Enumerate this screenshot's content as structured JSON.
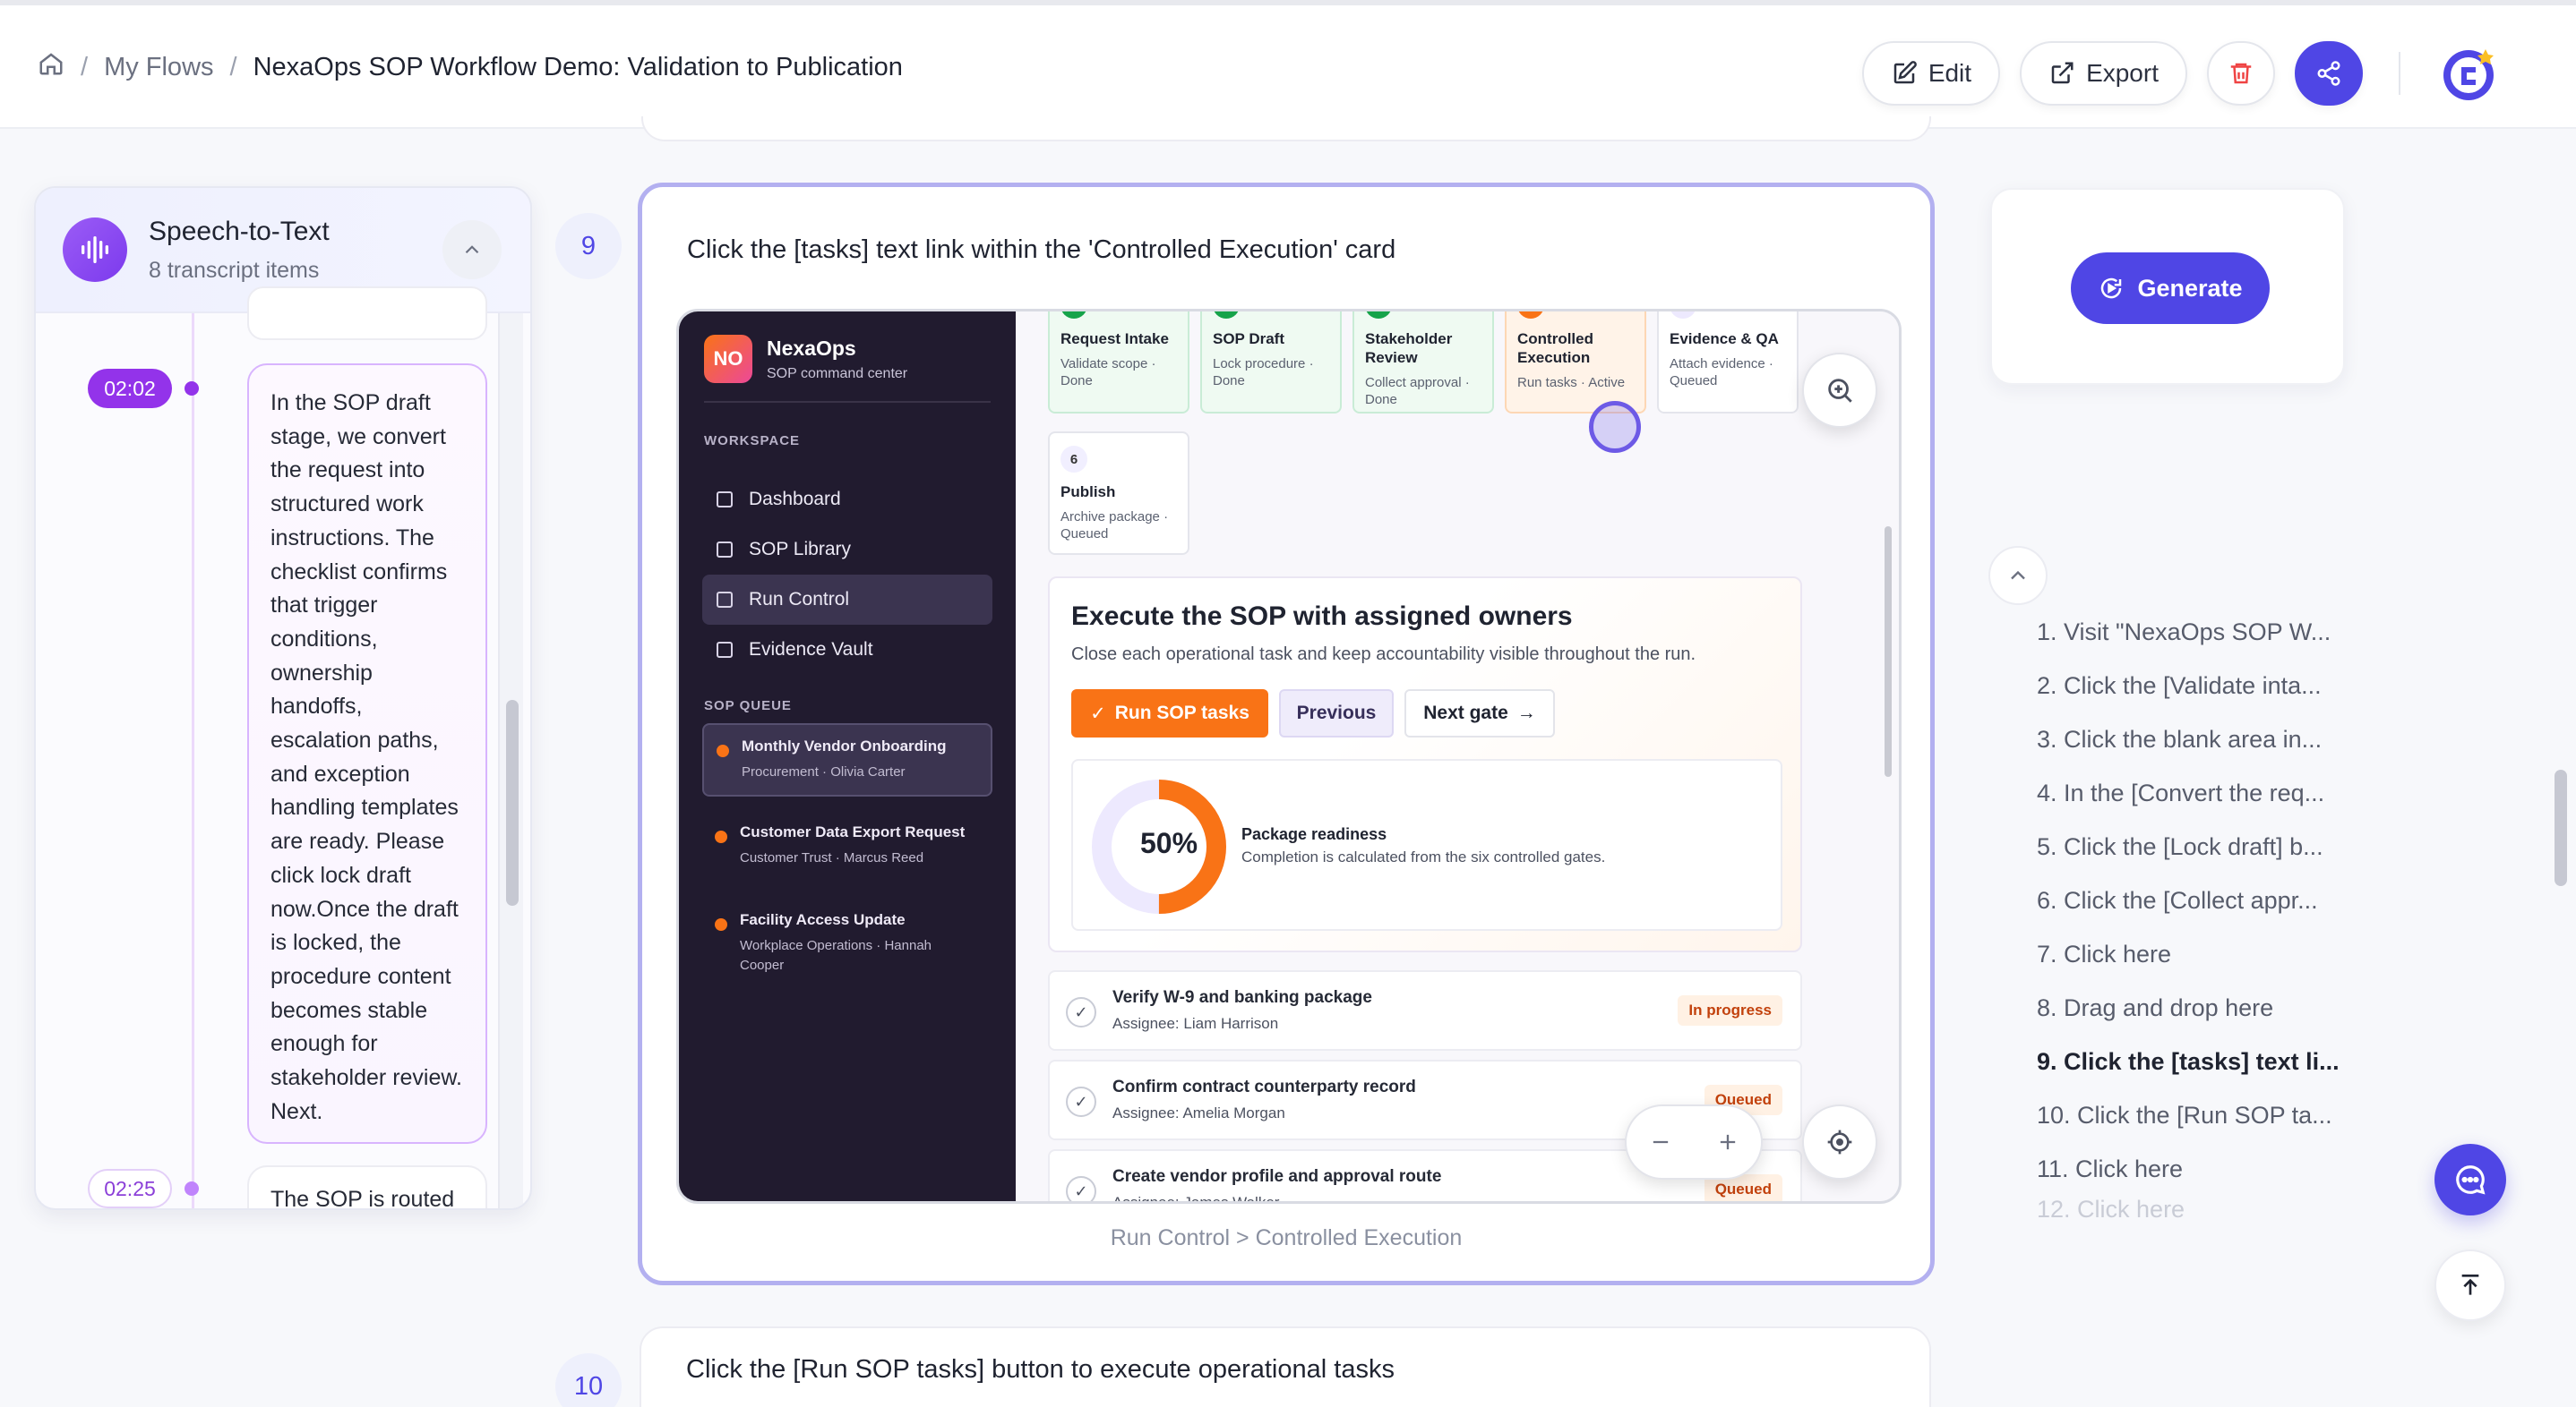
{
  "breadcrumb": {
    "home_icon": "home-icon",
    "parent": "My Flows",
    "current": "NexaOps SOP Workflow Demo: Validation to Publication",
    "separator": "/"
  },
  "header_actions": {
    "edit_label": "Edit",
    "export_label": "Export",
    "delete_icon": "trash-icon",
    "share_icon": "share-icon"
  },
  "speech_panel": {
    "title": "Speech-to-Text",
    "subtitle": "8 transcript items",
    "entries": [
      {
        "time": "02:02",
        "text": "In the SOP draft stage, we convert the request into structured work instructions. The checklist confirms that trigger conditions, ownership handoffs, escalation paths, and exception handling templates are ready. Please click lock draft now.Once the draft is locked, the procedure content becomes stable enough for stakeholder review. Next."
      },
      {
        "time": "02:25",
        "text": "The SOP is routed"
      }
    ]
  },
  "step9": {
    "number": "9",
    "title": "Click the [tasks] text link within the 'Controlled Execution' card",
    "caption": "Run Control > Controlled Execution",
    "app": {
      "logo": "NO",
      "name": "NexaOps",
      "tagline": "SOP command center",
      "workspace_label": "WORKSPACE",
      "nav": [
        "Dashboard",
        "SOP Library",
        "Run Control",
        "Evidence Vault"
      ],
      "queue_label": "SOP QUEUE",
      "queue": [
        {
          "title": "Monthly Vendor Onboarding",
          "sub": "Procurement · Olivia Carter"
        },
        {
          "title": "Customer Data Export Request",
          "sub": "Customer Trust · Marcus Reed"
        },
        {
          "title": "Facility Access Update",
          "sub": "Workplace Operations · Hannah Cooper"
        }
      ],
      "gates": [
        {
          "title": "Request Intake",
          "sub": "Validate scope · Done"
        },
        {
          "title": "SOP Draft",
          "sub": "Lock procedure · Done"
        },
        {
          "title": "Stakeholder Review",
          "sub": "Collect approval · Done"
        },
        {
          "title": "Controlled Execution",
          "sub": "Run tasks · Active"
        },
        {
          "title": "Evidence & QA",
          "sub": "Attach evidence · Queued"
        }
      ],
      "gate6": {
        "num": "6",
        "title": "Publish",
        "sub": "Archive package · Queued"
      },
      "exec": {
        "title": "Execute the SOP with assigned owners",
        "subtitle": "Close each operational task and keep accountability visible throughout the run.",
        "run_label": "Run SOP tasks",
        "prev_label": "Previous",
        "next_label": "Next gate",
        "readiness_pct": "50%",
        "readiness_value": 50,
        "readiness_title": "Package readiness",
        "readiness_sub": "Completion is calculated from the six controlled gates."
      },
      "tasks": [
        {
          "title": "Verify W-9 and banking package",
          "assignee": "Assignee: Liam Harrison",
          "status": "In progress"
        },
        {
          "title": "Confirm contract counterparty record",
          "assignee": "Assignee: Amelia Morgan",
          "status": "Queued"
        },
        {
          "title": "Create vendor profile and approval route",
          "assignee": "Assignee: James Walker",
          "status": "Queued"
        }
      ]
    }
  },
  "step10": {
    "number": "10",
    "title": "Click the [Run SOP tasks] button to execute operational tasks"
  },
  "generate_label": "Generate",
  "toc": [
    "1. Visit \"NexaOps SOP W...",
    "2. Click the [Validate inta...",
    "3. Click the blank area in...",
    "4. In the [Convert the req...",
    "5. Click the [Lock draft] b...",
    "6. Click the [Collect appr...",
    "7. Click here",
    "8. Drag and drop here",
    "9. Click the [tasks] text li...",
    "10. Click the [Run SOP ta...",
    "11. Click here",
    "12. Click here"
  ],
  "colors": {
    "accent": "#4f46e5",
    "transcript": "#9333ea",
    "app_orange": "#f97316",
    "done_green": "#16a34a"
  }
}
